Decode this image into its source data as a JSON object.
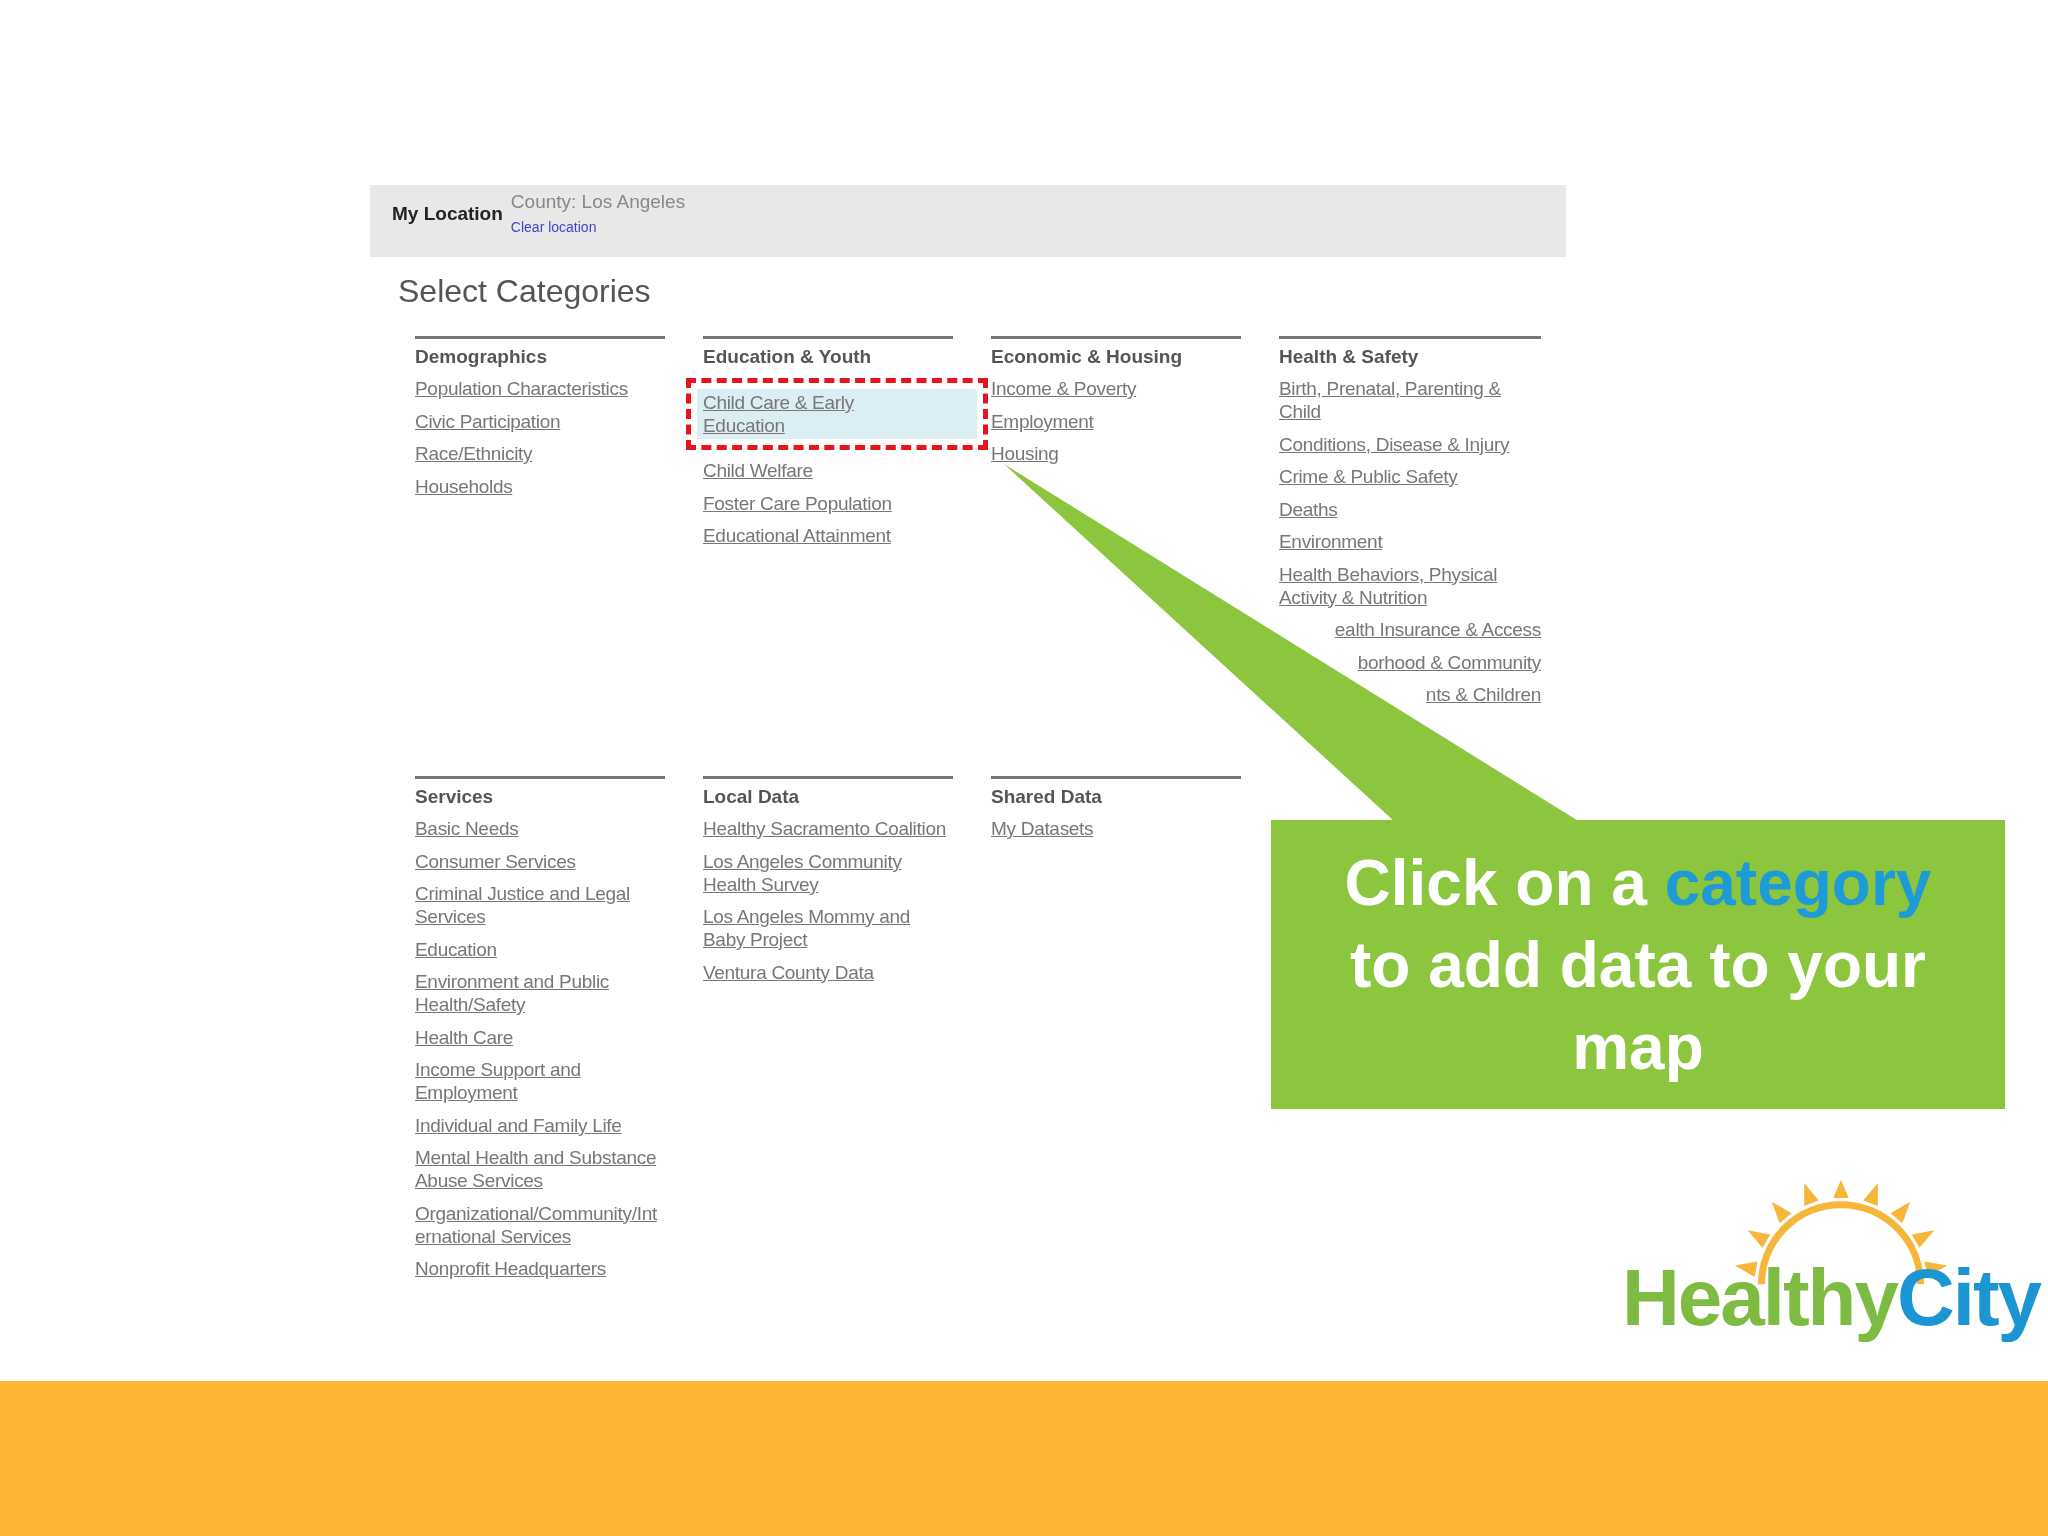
{
  "slide": {
    "location_bar": {
      "label": "My Location",
      "value": "County: Los Angeles",
      "link": "Clear location"
    },
    "title": "Select Categories",
    "groups": [
      {
        "heading": "Demographics",
        "items": [
          {
            "label": "Population Characteristics",
            "selected": false
          },
          {
            "label": "Civic Participation",
            "selected": false
          },
          {
            "label": "Race/Ethnicity",
            "selected": false
          },
          {
            "label": "Households",
            "selected": false
          }
        ]
      },
      {
        "heading": "Education & Youth",
        "items": [
          {
            "label": "Child Care & Early Education",
            "selected": true
          },
          {
            "label": "Child Welfare",
            "selected": false
          },
          {
            "label": "Foster Care Population",
            "selected": false
          },
          {
            "label": "Educational Attainment",
            "selected": false
          }
        ]
      },
      {
        "heading": "Economic & Housing",
        "items": [
          {
            "label": "Income & Poverty",
            "selected": false
          },
          {
            "label": "Employment",
            "selected": false
          },
          {
            "label": "Housing",
            "selected": false
          }
        ]
      },
      {
        "heading": "Health & Safety",
        "items": [
          {
            "label": "Birth, Prenatal, Parenting & Child",
            "selected": false,
            "kind": "link"
          },
          {
            "label": "Conditions, Disease & Injury",
            "selected": false,
            "kind": "link"
          },
          {
            "label": "Crime & Public Safety",
            "selected": false,
            "kind": "link"
          },
          {
            "label": "Deaths",
            "selected": false,
            "kind": "link"
          },
          {
            "label": "Environment",
            "selected": false,
            "kind": "link"
          },
          {
            "label": "Health Behaviors, Physical Activity & Nutrition",
            "selected": false,
            "kind": "link"
          },
          {
            "label": "ealth Insurance & Access",
            "selected": false,
            "kind": "partial"
          },
          {
            "label": "borhood & Community",
            "selected": false,
            "kind": "partial"
          },
          {
            "label": "nts & Children",
            "selected": false,
            "kind": "partial"
          }
        ]
      },
      {
        "heading": "Services",
        "items": [
          {
            "label": "Basic Needs",
            "selected": false
          },
          {
            "label": "Consumer Services",
            "selected": false
          },
          {
            "label": "Criminal Justice and Legal Services",
            "selected": false
          },
          {
            "label": "Education",
            "selected": false
          },
          {
            "label": "Environment and Public Health/Safety",
            "selected": false
          },
          {
            "label": "Health Care",
            "selected": false
          },
          {
            "label": "Income Support and Employment",
            "selected": false
          },
          {
            "label": "Individual and Family Life",
            "selected": false
          },
          {
            "label": "Mental Health and Substance Abuse Services",
            "selected": false
          },
          {
            "label": "Organizational/Community/International Services",
            "selected": false
          },
          {
            "label": "Nonprofit Headquarters",
            "selected": false
          }
        ]
      },
      {
        "heading": "Local Data",
        "items": [
          {
            "label": "Healthy Sacramento Coalition",
            "selected": false
          },
          {
            "label": "Los Angeles Community Health Survey",
            "selected": false
          },
          {
            "label": "Los Angeles Mommy and Baby Project",
            "selected": false
          },
          {
            "label": "Ventura County Data",
            "selected": false
          }
        ]
      },
      {
        "heading": "Shared Data",
        "items": [
          {
            "label": "My Datasets",
            "selected": false
          }
        ]
      }
    ],
    "callout": {
      "parts": [
        {
          "text": "Click on a ",
          "highlight": false
        },
        {
          "text": "category",
          "highlight": true
        },
        {
          "text": " to add data to your map",
          "highlight": false
        }
      ]
    },
    "logo": {
      "parts": [
        "Healthy",
        "City"
      ]
    }
  }
}
